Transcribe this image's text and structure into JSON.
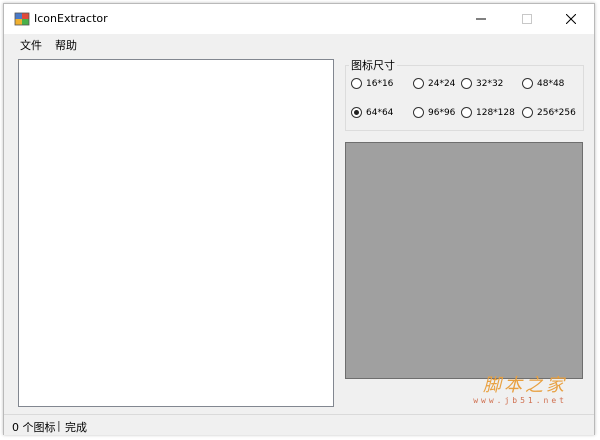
{
  "window": {
    "title": "IconExtractor"
  },
  "menu": {
    "items": [
      {
        "label": "文件"
      },
      {
        "label": "帮助"
      }
    ]
  },
  "icon_size_group": {
    "legend": "图标尺寸",
    "options": [
      {
        "label": "16*16",
        "checked": false
      },
      {
        "label": "24*24",
        "checked": false
      },
      {
        "label": "32*32",
        "checked": false
      },
      {
        "label": "48*48",
        "checked": false
      },
      {
        "label": "64*64",
        "checked": true
      },
      {
        "label": "96*96",
        "checked": false
      },
      {
        "label": "128*128",
        "checked": false
      },
      {
        "label": "256*256",
        "checked": false
      }
    ]
  },
  "status": {
    "count_text": "0 个图标",
    "separator": "|",
    "state_text": "完成"
  },
  "watermark": {
    "main": "脚本之家",
    "url": "www.jb51.net"
  },
  "colors": {
    "preview_background": "#a0a0a0",
    "window_background": "#f0f0f0"
  }
}
